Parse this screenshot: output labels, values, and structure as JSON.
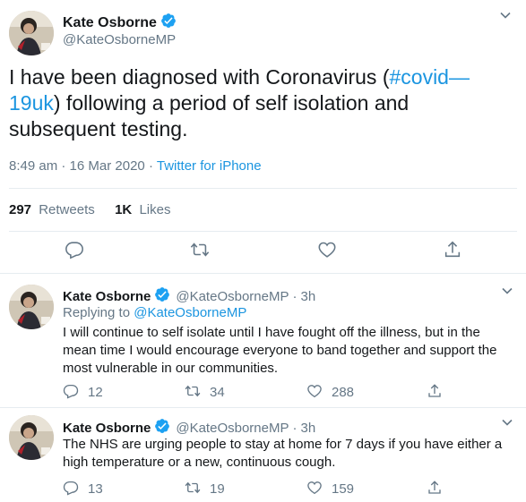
{
  "author": {
    "name": "Kate Osborne",
    "handle": "@KateOsborneMP"
  },
  "main_tweet": {
    "text_before": "I have been diagnosed with Coronavirus (",
    "hashtag": "#covid— 19uk",
    "text_after": ") following a period of self isolation and subsequent testing.",
    "time": "8:49 am",
    "dot": "·",
    "date": "16 Mar 2020",
    "source": "Twitter for iPhone",
    "retweets_count": "297",
    "retweets_label": "Retweets",
    "likes_count": "1K",
    "likes_label": "Likes"
  },
  "replies": [
    {
      "name": "Kate Osborne",
      "handle": "@KateOsborneMP",
      "sep": "·",
      "age": "3h",
      "replying_label": "Replying to",
      "replying_to": "@KateOsborneMP",
      "text": "I will continue to self isolate until I have fought off the illness, but in the mean time I would encourage everyone to band together and  support the most vulnerable in our communities.",
      "reply_count": "12",
      "retweet_count": "34",
      "like_count": "288"
    },
    {
      "name": "Kate Osborne",
      "handle": "@KateOsborneMP",
      "sep": "·",
      "age": "3h",
      "text": "The NHS are urging people to stay at home for 7 days if you have either a high temperature or a new, continuous cough.",
      "reply_count": "13",
      "retweet_count": "19",
      "like_count": "159"
    }
  ],
  "icons": {
    "caret": "chevron-down-icon",
    "reply": "reply-icon",
    "retweet": "retweet-icon",
    "like": "heart-icon",
    "share": "share-icon",
    "verified": "verified-badge-icon"
  },
  "colors": {
    "link": "#1b95e0",
    "muted": "#657786",
    "text": "#14171a",
    "verified": "#1da1f2"
  }
}
